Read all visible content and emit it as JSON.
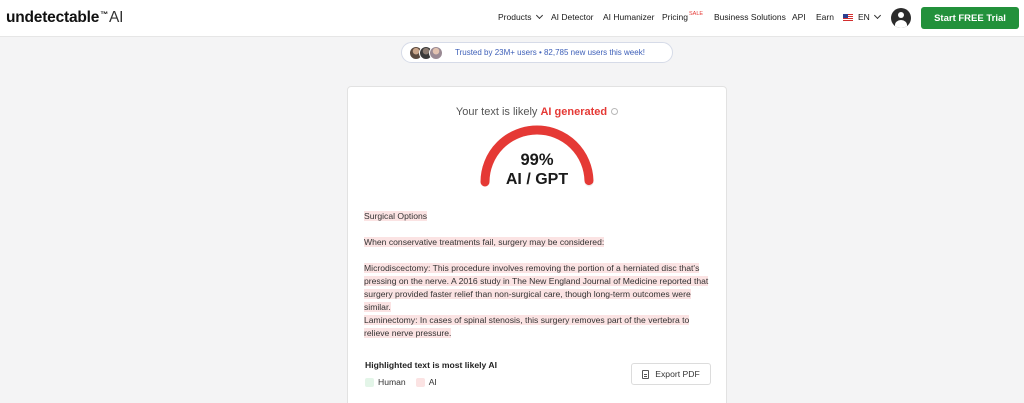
{
  "header": {
    "logo": {
      "brand": "undetectable",
      "tm": "™",
      "suffix": "AI"
    },
    "nav": {
      "products": "Products",
      "ai_detector": "AI Detector",
      "ai_humanizer": "AI Humanizer",
      "pricing": "Pricing",
      "pricing_badge": "SALE",
      "business_solutions": "Business Solutions",
      "api": "API",
      "earn": "Earn",
      "language": "EN"
    },
    "cta": "Start FREE Trial"
  },
  "trust_banner": {
    "text": "Trusted by 23M+ users • 82,785 new users this week!"
  },
  "result": {
    "verdict_prefix": "Your text is likely",
    "verdict_strong": "AI generated",
    "score": 0.99,
    "score_text": "99%",
    "score_label": "AI / GPT",
    "gauge_color": "#e53935"
  },
  "analyzed_text": {
    "heading": "Surgical Options",
    "p1": " When conservative treatments fail, surgery may be considered:",
    "p2": " Microdiscectomy: This procedure involves removing the portion of a herniated disc that's pressing on the nerve.  A 2016 study in The New England Journal of Medicine reported that surgery provided faster relief than non-surgical care, though long-term outcomes were similar.",
    "p3": " Laminectomy:  In cases of spinal stenosis, this surgery removes part of the vertebra to relieve nerve pressure."
  },
  "legend": {
    "title": "Highlighted text is most likely AI",
    "human_label": "Human",
    "ai_label": "AI",
    "human_color": "#e3f5e8",
    "ai_color": "#fbe3e3"
  },
  "export": {
    "label": "Export PDF"
  }
}
